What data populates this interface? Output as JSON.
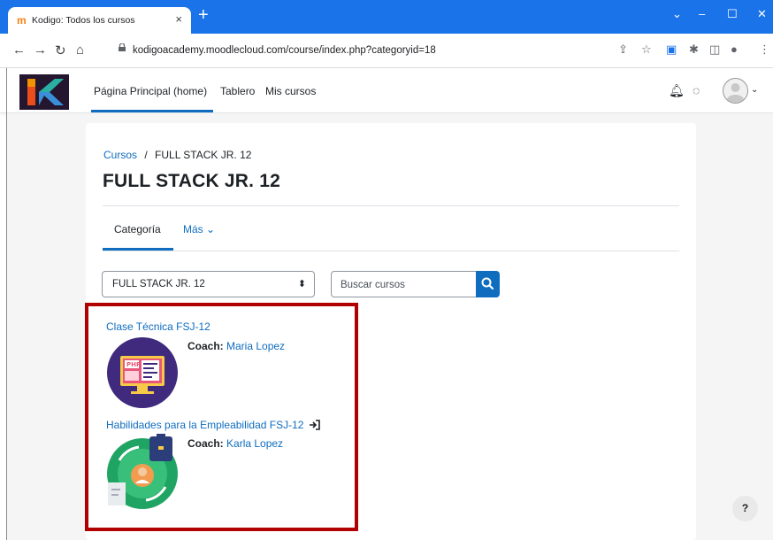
{
  "browser": {
    "tab_title": "Kodigo: Todos los cursos",
    "tab_favicon": "moodle-m",
    "tab_close": "×",
    "new_tab": "+",
    "url": "kodigoacademy.moodlecloud.com/course/index.php?categoryid=18",
    "window_controls": [
      "⌄",
      "–",
      "☐",
      "✕"
    ]
  },
  "navbar": {
    "items": [
      "Página Principal (home)",
      "Tablero",
      "Mis cursos"
    ],
    "active_index": 0
  },
  "breadcrumb": {
    "root": "Cursos",
    "separator": "/",
    "current": "FULL STACK JR. 12"
  },
  "page_title": "FULL STACK JR. 12",
  "secondary_nav": {
    "tabs": [
      "Categoría",
      "Más ⌄"
    ],
    "active_index": 0
  },
  "category_select": {
    "value": "FULL STACK JR. 12"
  },
  "search": {
    "placeholder": "Buscar cursos"
  },
  "courses": [
    {
      "name": "Clase Técnica FSJ-12",
      "coach_label": "Coach:",
      "coach_name": "Maria Lopez",
      "image_icon": "php-html-monitor-icon"
    },
    {
      "name": "Habilidades para la Empleabilidad FSJ-12",
      "coach_label": "Coach:",
      "coach_name": "Karla Lopez",
      "image_icon": "employability-cycle-icon",
      "enrol_icon": "sign-in-icon"
    }
  ],
  "help": {
    "label": "?"
  },
  "colors": {
    "chrome_blue": "#1a73e8",
    "moodle_blue": "#0f6cbf",
    "highlight_red": "#b00000",
    "logo_bg": "#24162e"
  }
}
